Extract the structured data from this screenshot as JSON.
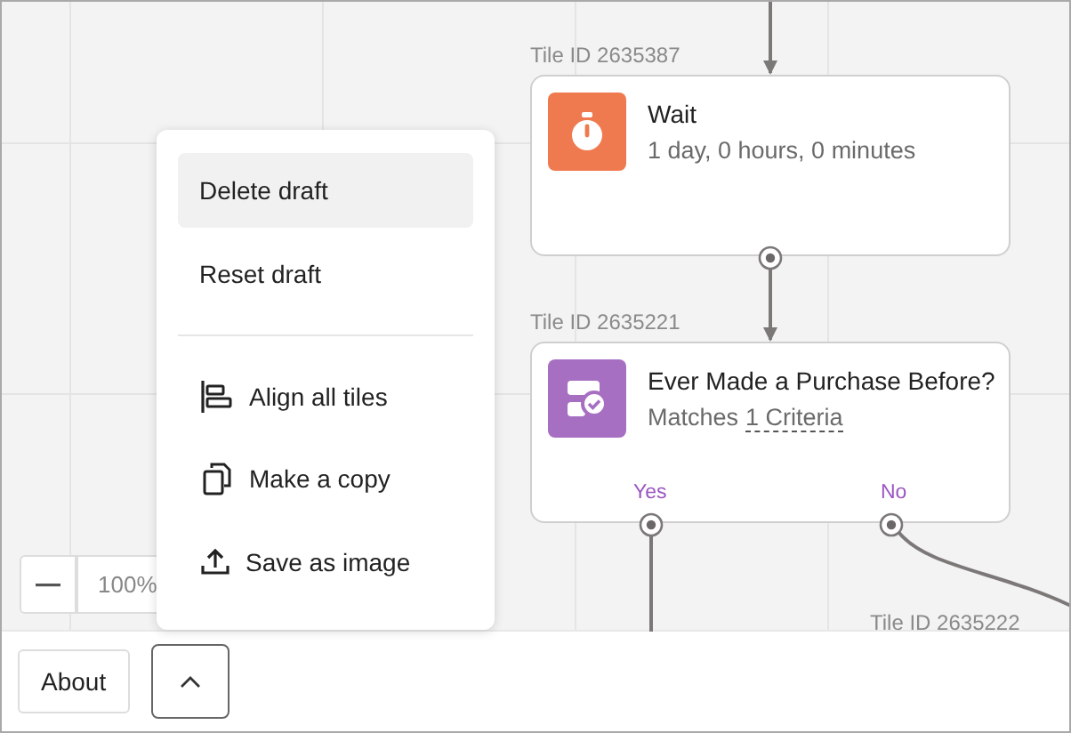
{
  "canvas": {
    "tiles": [
      {
        "tile_id": "Tile ID 2635387",
        "kind": "wait",
        "color": "#f07a50",
        "title": "Wait",
        "subtitle": "1 day, 0 hours, 0 minutes"
      },
      {
        "tile_id": "Tile ID 2635221",
        "kind": "condition",
        "color": "#a76fc2",
        "title": "Ever Made a Purchase Before?",
        "subtitle": "Matches",
        "subtitle_link": "1 Criteria",
        "branches": [
          "Yes",
          "No"
        ]
      }
    ],
    "offscreen_tile_id": "Tile ID 2635222",
    "zoom": {
      "level_text": "100%"
    }
  },
  "menu": {
    "items": [
      {
        "kind": "text",
        "label": "Delete draft",
        "selected": true
      },
      {
        "kind": "text",
        "label": "Reset draft",
        "selected": false
      },
      {
        "kind": "divider"
      },
      {
        "kind": "align",
        "label": "Align all tiles",
        "selected": false
      },
      {
        "kind": "copy",
        "label": "Make a copy",
        "selected": false
      },
      {
        "kind": "export",
        "label": "Save as image",
        "selected": false
      }
    ]
  },
  "footer": {
    "about": "About"
  }
}
